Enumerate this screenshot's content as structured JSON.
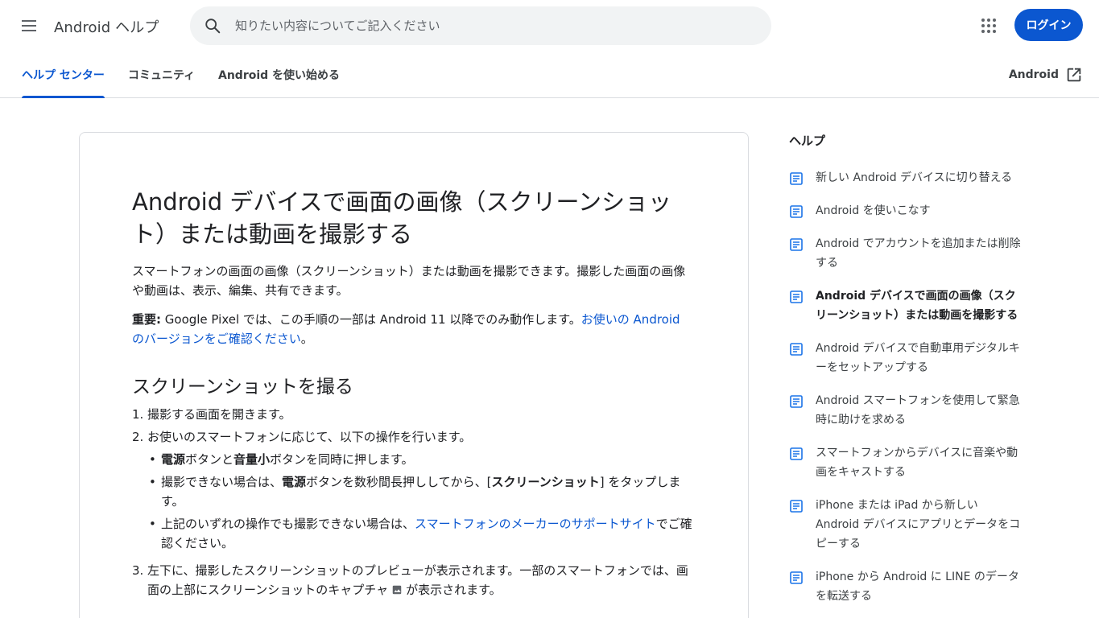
{
  "header": {
    "app_title": "Android ヘルプ",
    "search_placeholder": "知りたい内容についてご記入ください",
    "login_label": "ログイン"
  },
  "tabs": [
    {
      "label": "ヘルプ センター",
      "active": true
    },
    {
      "label": "コミュニティ",
      "active": false
    },
    {
      "label": "Android を使い始める",
      "active": false
    }
  ],
  "external_link": "Android",
  "article": {
    "title": "Android デバイスで画面の画像（スクリーンショット）または動画を撮影する",
    "intro": "スマートフォンの画面の画像（スクリーンショット）または動画を撮影できます。撮影した画面の画像や動画は、表示、編集、共有できます。",
    "important_label": "重要:",
    "important_text": " Google Pixel では、この手順の一部は Android 11 以降でのみ動作します。",
    "important_link": "お使いの Android のバージョンをご確認ください",
    "important_end": "。",
    "section_title": "スクリーンショットを撮る",
    "step1": "撮影する画面を開きます。",
    "step2": "お使いのスマートフォンに応じて、以下の操作を行います。",
    "bullet1": {
      "b1": "電源",
      "t1": "ボタンと",
      "b2": "音量小",
      "t2": "ボタンを同時に押します。"
    },
    "bullet2": {
      "t1": "撮影できない場合は、",
      "b1": "電源",
      "t2": "ボタンを数秒間長押ししてから、[",
      "b2": "スクリーンショット",
      "t3": "] をタップします。"
    },
    "bullet3": {
      "t1": "上記のいずれの操作でも撮影できない場合は、",
      "link": "スマートフォンのメーカーのサポートサイト",
      "t2": "でご確認ください。"
    },
    "step3_a": "左下に、撮影したスクリーンショットのプレビューが表示されます。一部のスマートフォンでは、画面の上部にスクリーンショットのキャプチャ",
    "step3_b": "が表示されます。"
  },
  "sidebar": {
    "heading": "ヘルプ",
    "items": [
      {
        "label": "新しい Android デバイスに切り替える"
      },
      {
        "label": "Android を使いこなす"
      },
      {
        "label": "Android でアカウントを追加または削除する"
      },
      {
        "label": "Android デバイスで画面の画像（スクリーンショット）または動画を撮影する",
        "current": true
      },
      {
        "label": "Android デバイスで自動車用デジタルキーをセットアップする"
      },
      {
        "label": "Android スマートフォンを使用して緊急時に助けを求める"
      },
      {
        "label": "スマートフォンからデバイスに音楽や動画をキャストする"
      },
      {
        "label": "iPhone または iPad から新しい Android デバイスにアプリとデータをコピーする"
      },
      {
        "label": "iPhone から Android に LINE のデータを転送する"
      }
    ]
  },
  "colors": {
    "accent": "#0b57d0",
    "text": "#202124",
    "muted": "#3c4043",
    "border": "#dadce0"
  }
}
